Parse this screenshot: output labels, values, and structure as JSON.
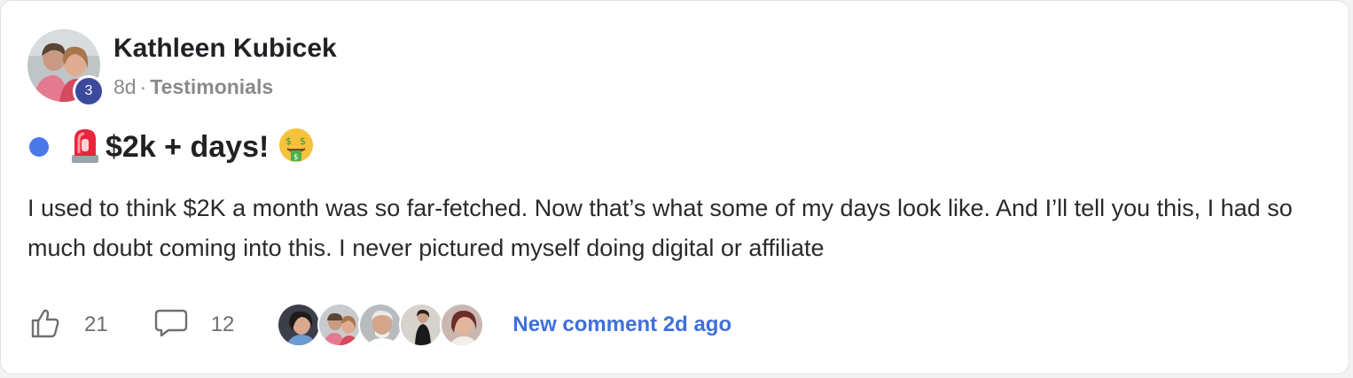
{
  "post": {
    "author": {
      "name": "Kathleen Kubicek",
      "level": "3",
      "avatar_icon": "user-avatar-photo"
    },
    "meta": {
      "time": "8d",
      "separator": "·",
      "category": "Testimonials"
    },
    "unread": true,
    "title": "$2k + days!",
    "title_icons": [
      "rotating-light-icon",
      "money-mouth-face-icon"
    ],
    "body": "I used to think $2K a month was so far-fetched. Now that’s what some of my days look like. And I’ll tell you this, I had so much doubt coming into this. I never pictured myself doing digital or affiliate",
    "likes": "21",
    "comments": "12",
    "commenter_avatars": [
      "commenter-avatar-1",
      "commenter-avatar-2",
      "commenter-avatar-3",
      "commenter-avatar-4",
      "commenter-avatar-5"
    ],
    "new_comment": "New comment 2d ago"
  },
  "colors": {
    "accent": "#3f6fdb",
    "unread_dot": "#4a78e8",
    "level_badge": "#3c4a9c",
    "text_primary": "#202124",
    "text_muted": "#8a8a8a"
  }
}
